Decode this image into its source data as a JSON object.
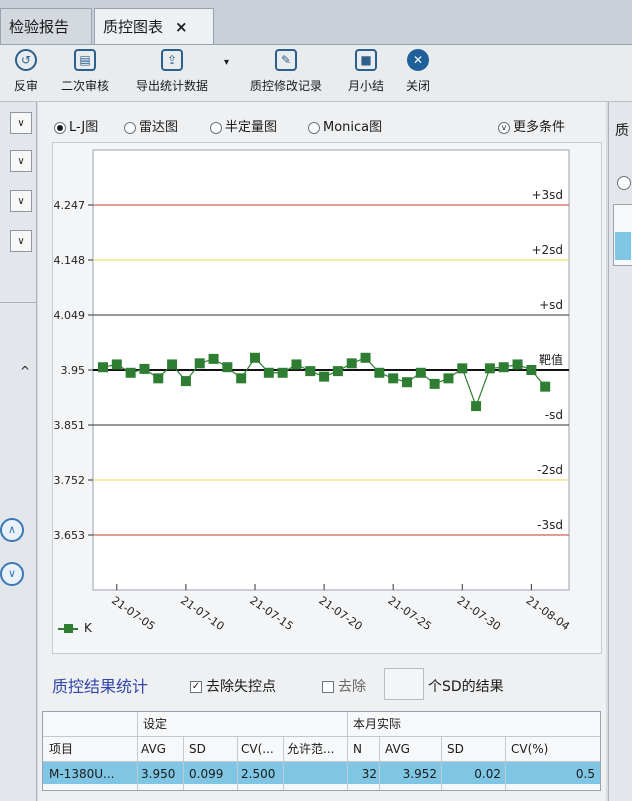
{
  "tabs": [
    {
      "label": "检验报告"
    },
    {
      "label": "质控图表",
      "close": "×"
    }
  ],
  "toolbar": [
    {
      "label": "反审",
      "icon": "undo-icon",
      "glyph": "↺"
    },
    {
      "label": "二次审核",
      "icon": "review-icon",
      "glyph": "▤"
    },
    {
      "label": "导出统计数据",
      "icon": "export-icon",
      "glyph": "⇪"
    },
    {
      "label": "质控修改记录",
      "icon": "edit-record-icon",
      "glyph": "✎"
    },
    {
      "label": "月小结",
      "icon": "save-icon",
      "glyph": "■"
    },
    {
      "label": "关闭",
      "icon": "close-icon",
      "glyph": "✕"
    }
  ],
  "dropdown_glyph": "∨",
  "left_nav": {
    "collapse": "^",
    "up": "∧",
    "down": "∨"
  },
  "chart_options": {
    "radios": [
      {
        "label": "L-J图",
        "selected": true
      },
      {
        "label": "雷达图",
        "selected": false
      },
      {
        "label": "半定量图",
        "selected": false
      },
      {
        "label": "Monica图",
        "selected": false
      }
    ],
    "more_label": "更多条件",
    "more_icon": "chevron-down-circle-icon"
  },
  "right_panel_text": "质",
  "chart_data": {
    "type": "line",
    "y_ticks": [
      "4.247",
      "4.148",
      "4.049",
      "3.95",
      "3.851",
      "3.752",
      "3.653"
    ],
    "y_values": [
      4.247,
      4.148,
      4.049,
      3.95,
      3.851,
      3.752,
      3.653
    ],
    "ylim": [
      3.554,
      4.346
    ],
    "sd_labels": [
      "+3sd",
      "+2sd",
      "+sd",
      "靶值",
      "-sd",
      "-2sd",
      "-3sd"
    ],
    "sd_colors": [
      "#c0392b",
      "#e5d84a",
      "#333333",
      "#111111",
      "#333333",
      "#e5d84a",
      "#c0392b"
    ],
    "x_ticks": [
      "21-07-05",
      "21-07-10",
      "21-07-15",
      "21-07-20",
      "21-07-25",
      "21-07-30",
      "21-08-04"
    ],
    "x_tick_days": [
      5,
      10,
      15,
      20,
      25,
      30,
      35
    ],
    "xlim": [
      4,
      37
    ],
    "series": [
      {
        "name": "K",
        "color": "#2e7d32",
        "x": [
          4,
          5,
          6,
          7,
          8,
          9,
          10,
          11,
          12,
          13,
          14,
          15,
          16,
          17,
          18,
          19,
          20,
          21,
          22,
          23,
          24,
          25,
          26,
          27,
          28,
          29,
          30,
          31,
          32,
          33,
          34,
          35,
          36
        ],
        "y": [
          3.955,
          3.96,
          3.945,
          3.952,
          3.935,
          3.96,
          3.93,
          3.962,
          3.97,
          3.955,
          3.935,
          3.972,
          3.945,
          3.945,
          3.96,
          3.948,
          3.938,
          3.948,
          3.962,
          3.972,
          3.945,
          3.935,
          3.928,
          3.945,
          3.925,
          3.935,
          3.953,
          3.885,
          3.953,
          3.955,
          3.96,
          3.95,
          3.92
        ]
      }
    ],
    "legend": "bottom-left"
  },
  "stats": {
    "title": "质控结果统计",
    "remove_out_of_control": {
      "label": "去除失控点",
      "checked": true
    },
    "remove_sd": {
      "label": "去除",
      "checked": false,
      "suffix": "个SD的结果",
      "value": ""
    },
    "group_headers": [
      "设定",
      "本月实际"
    ],
    "columns": [
      "项目",
      "AVG",
      "SD",
      "CV(...",
      "允许范...",
      "N",
      "AVG",
      "SD",
      "CV(%)"
    ],
    "rows": [
      [
        "M-1380U...",
        "3.950",
        "0.099",
        "2.500",
        "",
        "32",
        "3.952",
        "0.02",
        "0.5"
      ]
    ]
  }
}
